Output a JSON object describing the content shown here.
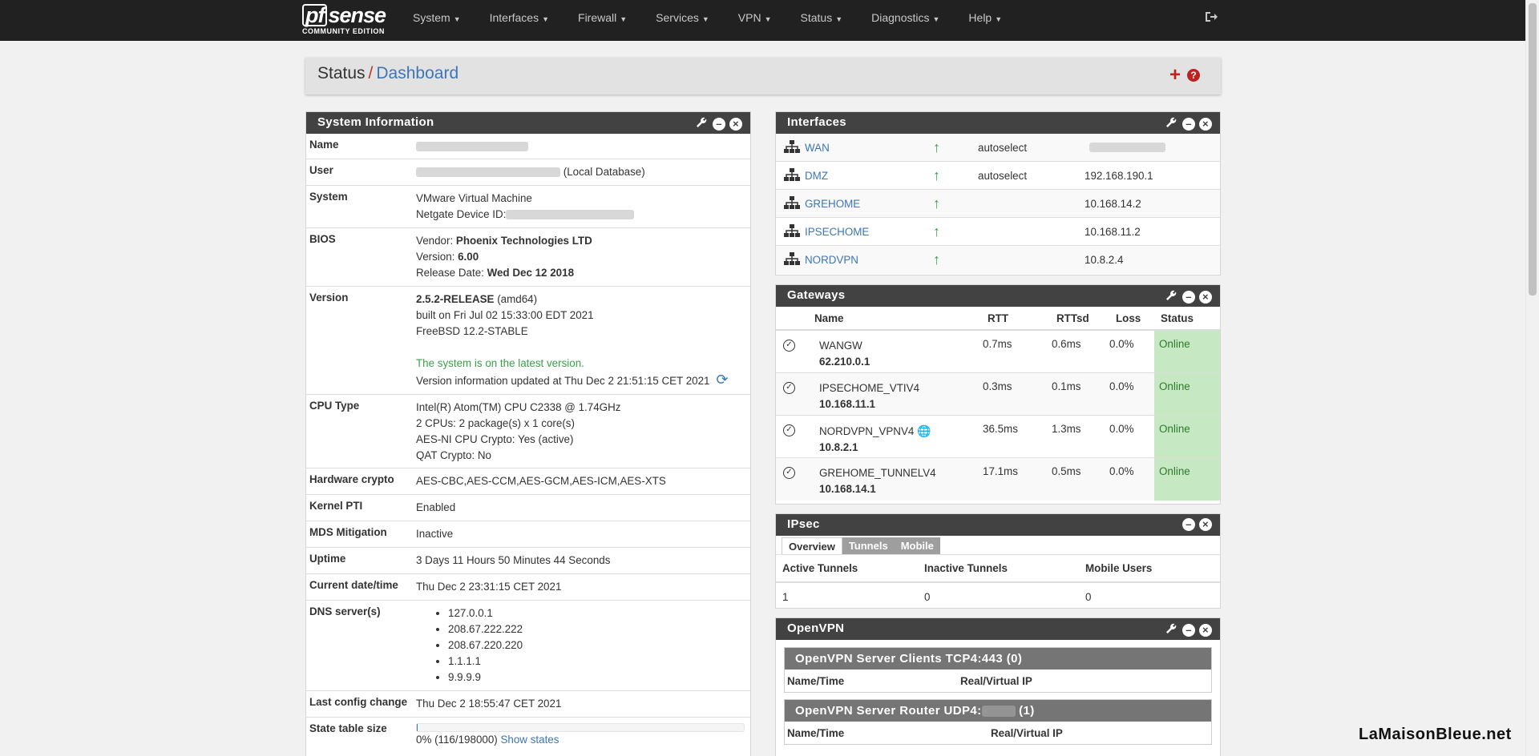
{
  "nav": {
    "logo_main": "sense",
    "logo_pf": "pf",
    "logo_sub": "COMMUNITY EDITION",
    "items": [
      {
        "label": "System"
      },
      {
        "label": "Interfaces"
      },
      {
        "label": "Firewall"
      },
      {
        "label": "Services"
      },
      {
        "label": "VPN"
      },
      {
        "label": "Status"
      },
      {
        "label": "Diagnostics"
      },
      {
        "label": "Help"
      }
    ],
    "caret": "▼",
    "logout_icon": "sign-out-icon"
  },
  "breadcrumb": {
    "section": "Status",
    "separator": "/",
    "page": "Dashboard",
    "add_glyph": "+",
    "help_glyph": "?"
  },
  "system_info": {
    "title": "System Information",
    "name_label": "Name",
    "user_label": "User",
    "user_suffix": "(Local Database)",
    "system_label": "System",
    "system_line1": "VMware Virtual Machine",
    "system_line2": "Netgate Device ID:",
    "bios_label": "BIOS",
    "bios_vendor_label": "Vendor: ",
    "bios_vendor": "Phoenix Technologies LTD",
    "bios_version_label": "Version: ",
    "bios_version": "6.00",
    "bios_date_label": "Release Date: ",
    "bios_date": "Wed Dec 12 2018",
    "version_label": "Version",
    "version_release": "2.5.2-RELEASE",
    "version_arch": " (amd64)",
    "version_built": "built on Fri Jul 02 15:33:00 EDT 2021",
    "version_os": "FreeBSD 12.2-STABLE",
    "version_status": "The system is on the latest version.",
    "version_updated": "Version information updated at Thu Dec 2 21:51:15 CET 2021",
    "cpu_label": "CPU Type",
    "cpu_line1": "Intel(R) Atom(TM) CPU C2338 @ 1.74GHz",
    "cpu_line2": "2 CPUs: 2 package(s) x 1 core(s)",
    "cpu_line3": "AES-NI CPU Crypto: Yes (active)",
    "cpu_line4": "QAT Crypto: No",
    "hwcrypto_label": "Hardware crypto",
    "hwcrypto": "AES-CBC,AES-CCM,AES-GCM,AES-ICM,AES-XTS",
    "kpti_label": "Kernel PTI",
    "kpti": "Enabled",
    "mds_label": "MDS Mitigation",
    "mds": "Inactive",
    "uptime_label": "Uptime",
    "uptime": "3 Days 11 Hours 50 Minutes 44 Seconds",
    "datetime_label": "Current date/time",
    "datetime": "Thu Dec 2 23:31:15 CET 2021",
    "dns_label": "DNS server(s)",
    "dns": [
      "127.0.0.1",
      "208.67.222.222",
      "208.67.220.220",
      "1.1.1.1",
      "9.9.9.9"
    ],
    "lastconfig_label": "Last config change",
    "lastconfig": "Thu Dec 2 18:55:47 CET 2021",
    "state_label": "State table size",
    "state_value": "0% (116/198000)",
    "state_fill_fraction": 0.0006,
    "show_states": "Show states"
  },
  "interfaces": {
    "title": "Interfaces",
    "rows": [
      {
        "name": "WAN",
        "media": "autoselect",
        "ip": ""
      },
      {
        "name": "DMZ",
        "media": "autoselect",
        "ip": "192.168.190.1"
      },
      {
        "name": "GREHOME",
        "media": "",
        "ip": "10.168.14.2"
      },
      {
        "name": "IPSECHOME",
        "media": "",
        "ip": "10.168.11.2"
      },
      {
        "name": "NORDVPN",
        "media": "",
        "ip": "10.8.2.4"
      }
    ]
  },
  "gateways": {
    "title": "Gateways",
    "headers": {
      "name": "Name",
      "rtt": "RTT",
      "rttsd": "RTTsd",
      "loss": "Loss",
      "status": "Status"
    },
    "rows": [
      {
        "name": "WANGW",
        "ip": "62.210.0.1",
        "rtt": "0.7ms",
        "rttsd": "0.6ms",
        "loss": "0.0%",
        "status": "Online"
      },
      {
        "name": "IPSECHOME_VTIV4",
        "ip": "10.168.11.1",
        "rtt": "0.3ms",
        "rttsd": "0.1ms",
        "loss": "0.0%",
        "status": "Online"
      },
      {
        "name": "NORDVPN_VPNV4",
        "ip": "10.8.2.1",
        "rtt": "36.5ms",
        "rttsd": "1.3ms",
        "loss": "0.0%",
        "status": "Online"
      },
      {
        "name": "GREHOME_TUNNELV4",
        "ip": "10.168.14.1",
        "rtt": "17.1ms",
        "rttsd": "0.5ms",
        "loss": "0.0%",
        "status": "Online"
      }
    ]
  },
  "ipsec": {
    "title": "IPsec",
    "tabs": [
      "Overview",
      "Tunnels",
      "Mobile"
    ],
    "headers": [
      "Active Tunnels",
      "Inactive Tunnels",
      "Mobile Users"
    ],
    "values": [
      "1",
      "0",
      "0"
    ]
  },
  "openvpn": {
    "title": "OpenVPN",
    "server1_title": "OpenVPN Server Clients TCP4:443 (0)",
    "server1_cols": [
      "Name/Time",
      "Real/Virtual IP"
    ],
    "server2_title_prefix": "OpenVPN Server Router UDP4:",
    "server2_title_suffix": " (1)",
    "server2_cols": [
      "Name/Time",
      "Real/Virtual IP"
    ]
  },
  "watermark": "LaMaisonBleue.net"
}
